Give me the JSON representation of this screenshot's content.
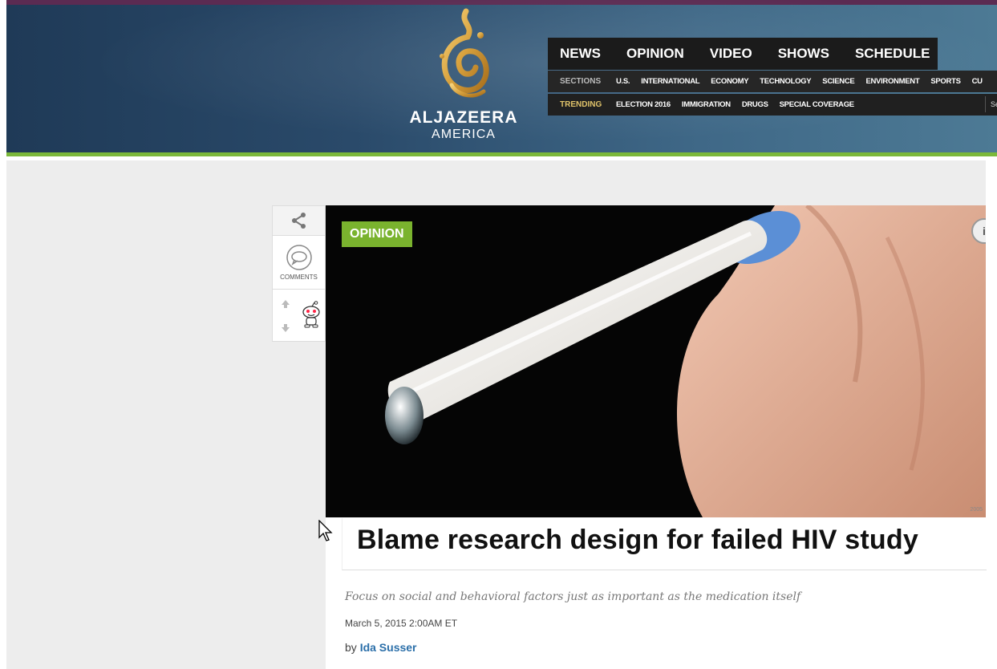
{
  "header": {
    "brand": "ALJAZEERA",
    "brand_sub": "AMERICA",
    "nav": [
      "NEWS",
      "OPINION",
      "VIDEO",
      "SHOWS",
      "SCHEDULE"
    ],
    "sections_label": "SECTIONS",
    "sections": [
      "U.S.",
      "INTERNATIONAL",
      "ECONOMY",
      "TECHNOLOGY",
      "SCIENCE",
      "ENVIRONMENT",
      "SPORTS",
      "CU"
    ],
    "trending_label": "TRENDING",
    "trending": [
      "ELECTION 2016",
      "IMMIGRATION",
      "DRUGS",
      "SPECIAL COVERAGE"
    ],
    "search_placeholder": "Se"
  },
  "sidebar": {
    "comments_label": "COMMENTS"
  },
  "article": {
    "badge": "OPINION",
    "image_credit": "2005",
    "info_icon": "i",
    "headline": "Blame research design for failed HIV study",
    "subheadline": "Focus on social and behavioral factors just as important as the medication itself",
    "date": "March 5, 2015 2:00AM ET",
    "byline_prefix": "by",
    "author": "Ida Susser"
  },
  "colors": {
    "accent_green": "#7bb83a",
    "author_link": "#2b6fa9",
    "trending": "#e0c36a"
  }
}
